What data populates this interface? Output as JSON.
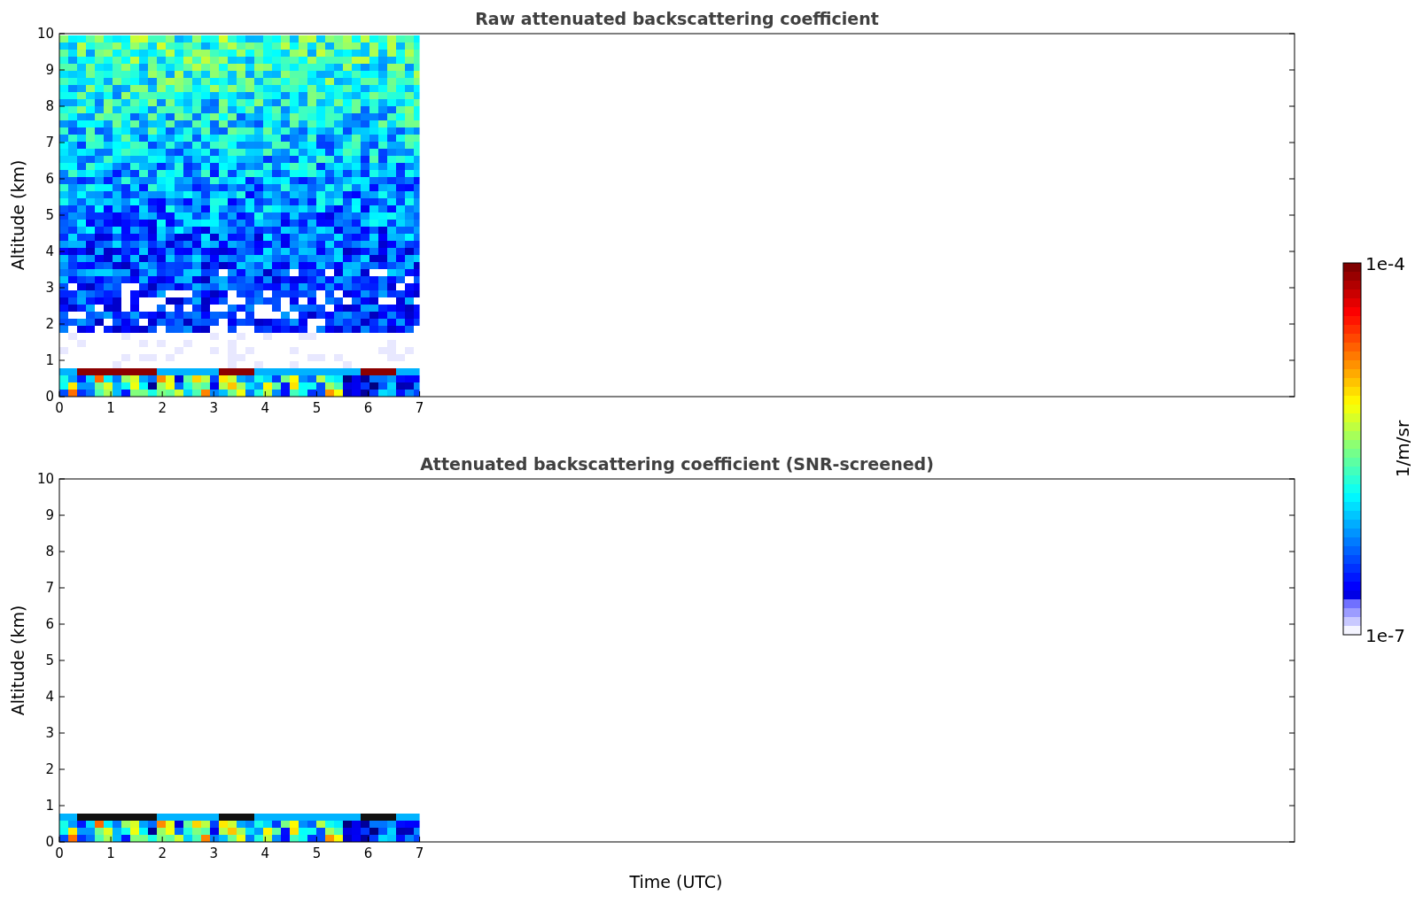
{
  "panels": [
    {
      "kind": "raw",
      "title": "Raw attenuated backscattering coefficient",
      "ylabel": "Altitude (km)",
      "yticks": [
        "10",
        "9",
        "8",
        "7",
        "6",
        "5",
        "4",
        "3",
        "2",
        "1",
        "0"
      ],
      "xticks": [
        "0",
        "1",
        "2",
        "3",
        "4",
        "5",
        "6",
        "7"
      ]
    },
    {
      "kind": "screened",
      "title": "Attenuated backscattering coefficient (SNR-screened)",
      "ylabel": "Altitude (km)",
      "yticks": [
        "10",
        "9",
        "8",
        "7",
        "6",
        "5",
        "4",
        "3",
        "2",
        "1",
        "0"
      ],
      "xticks": [
        "0",
        "1",
        "2",
        "3",
        "4",
        "5",
        "6",
        "7"
      ]
    }
  ],
  "xlabel": "Time (UTC)",
  "colorbar": {
    "max_label": "1e-4",
    "min_label": "1e-7",
    "unit": "1/m/sr"
  }
}
